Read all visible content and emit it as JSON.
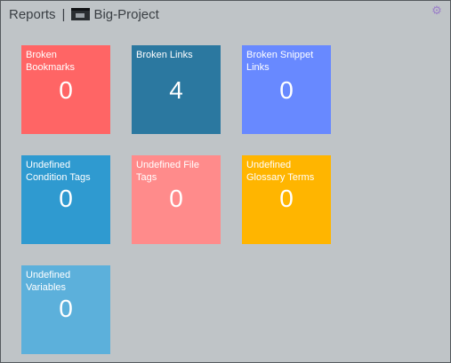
{
  "header": {
    "section": "Reports",
    "separator": "|",
    "project_name": "Big-Project",
    "project_icon": "project-folder-icon",
    "settings_icon": "gear-icon"
  },
  "colors": {
    "background": "#bfc4c7",
    "broken_bookmarks": "#ff6565",
    "broken_links": "#2b78a0",
    "broken_snippet_links": "#6889ff",
    "undefined_condition_tags": "#2f9ad0",
    "undefined_file_tags": "#ff8b8b",
    "undefined_glossary_terms": "#ffb500",
    "undefined_variables": "#5cb0db"
  },
  "tiles": [
    {
      "label": "Broken Bookmarks",
      "count": "0"
    },
    {
      "label": "Broken Links",
      "count": "4"
    },
    {
      "label": "Broken Snippet Links",
      "count": "0"
    },
    {
      "label": "Undefined Condition Tags",
      "count": "0"
    },
    {
      "label": "Undefined File Tags",
      "count": "0"
    },
    {
      "label": "Undefined Glossary Terms",
      "count": "0"
    },
    {
      "label": "Undefined Variables",
      "count": "0"
    }
  ]
}
